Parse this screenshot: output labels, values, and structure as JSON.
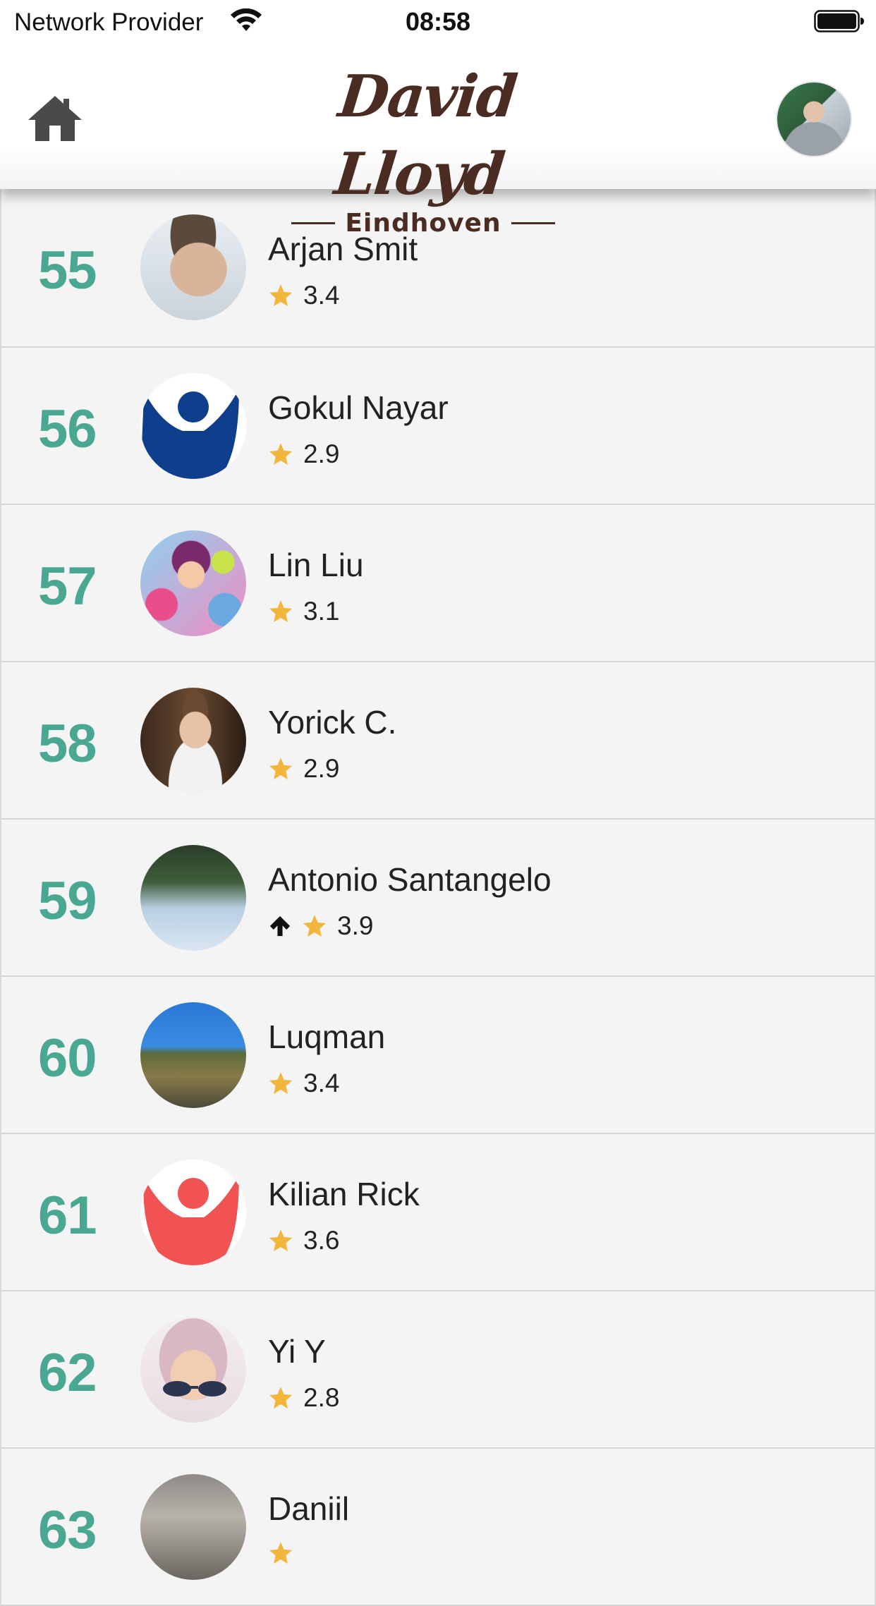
{
  "status_bar": {
    "provider": "Network Provider",
    "time": "08:58"
  },
  "header": {
    "logo_script": "David Lloyd",
    "logo_sub": "Eindhoven",
    "icons": {
      "home": "home-icon",
      "profile": "profile-avatar"
    }
  },
  "players": [
    {
      "rank": "55",
      "name": "Arjan Smit",
      "rating": "3.4",
      "trend": ""
    },
    {
      "rank": "56",
      "name": "Gokul Nayar",
      "rating": "2.9",
      "trend": ""
    },
    {
      "rank": "57",
      "name": "Lin Liu",
      "rating": "3.1",
      "trend": ""
    },
    {
      "rank": "58",
      "name": "Yorick C.",
      "rating": "2.9",
      "trend": ""
    },
    {
      "rank": "59",
      "name": "Antonio Santangelo",
      "rating": "3.9",
      "trend": "up"
    },
    {
      "rank": "60",
      "name": "Luqman",
      "rating": "3.4",
      "trend": ""
    },
    {
      "rank": "61",
      "name": "Kilian Rick",
      "rating": "3.6",
      "trend": ""
    },
    {
      "rank": "62",
      "name": "Yi Y",
      "rating": "2.8",
      "trend": ""
    },
    {
      "rank": "63",
      "name": "Daniil",
      "rating": "",
      "trend": ""
    }
  ],
  "colors": {
    "rank": "#4aa892",
    "star": "#f2b63c",
    "logo": "#4b2c22"
  }
}
